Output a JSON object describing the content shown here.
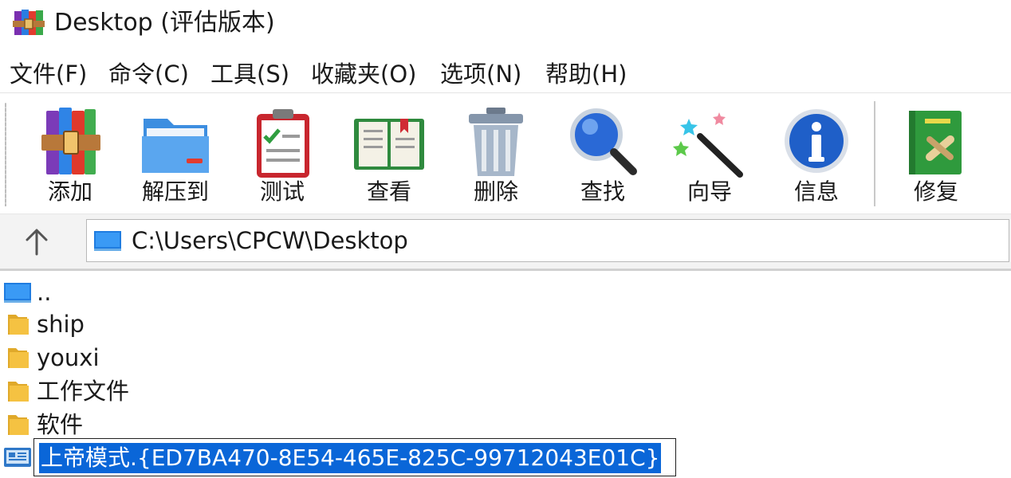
{
  "window": {
    "title": "Desktop (评估版本)"
  },
  "menu": {
    "items": [
      "文件(F)",
      "命令(C)",
      "工具(S)",
      "收藏夹(O)",
      "选项(N)",
      "帮助(H)"
    ]
  },
  "toolbar": {
    "buttons": [
      {
        "label": "添加",
        "icon": "books-archive-icon"
      },
      {
        "label": "解压到",
        "icon": "folder-icon"
      },
      {
        "label": "测试",
        "icon": "clipboard-check-icon"
      },
      {
        "label": "查看",
        "icon": "open-book-icon"
      },
      {
        "label": "删除",
        "icon": "trash-can-icon"
      },
      {
        "label": "查找",
        "icon": "magnifier-icon"
      },
      {
        "label": "向导",
        "icon": "magic-wand-icon"
      },
      {
        "label": "信息",
        "icon": "info-icon"
      },
      {
        "label": "修复",
        "icon": "repair-book-icon"
      }
    ]
  },
  "address": {
    "path": "C:\\Users\\CPCW\\Desktop",
    "icon": "desktop-icon"
  },
  "files": [
    {
      "name": "..",
      "icon": "desktop-icon"
    },
    {
      "name": "ship",
      "icon": "folder-icon"
    },
    {
      "name": "youxi",
      "icon": "folder-icon"
    },
    {
      "name": "工作文件",
      "icon": "folder-icon"
    },
    {
      "name": "软件",
      "icon": "folder-icon"
    },
    {
      "name": "上帝模式.{ED7BA470-8E54-465E-825C-99712043E01C}",
      "icon": "control-panel-icon",
      "renaming": true
    }
  ],
  "colors": {
    "selection": "#0a66d8",
    "folder": "#f5c242"
  }
}
